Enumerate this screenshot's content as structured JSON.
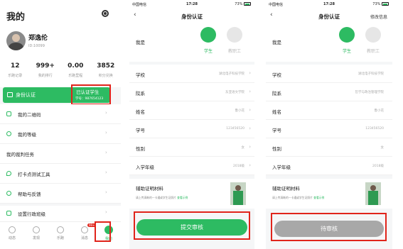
{
  "colors": {
    "accent": "#2dbb62",
    "highlight": "#e0241b",
    "disabled": "#a8a8a8"
  },
  "profile": {
    "title": "我的",
    "name": "郑逸伦",
    "id": "ID:10099",
    "stats": [
      {
        "value": "12",
        "label": "乐跑记录"
      },
      {
        "value": "999+",
        "label": "我的排行"
      },
      {
        "value": "0.00",
        "label": "乐跑里程"
      },
      {
        "value": "3852",
        "label": "积分兑换"
      }
    ],
    "auth": {
      "label": "身份认证",
      "status": "已认证学生",
      "student_id": "学号：987654123"
    },
    "menu": [
      {
        "label": "我的二维码",
        "icon": "qrcode-icon"
      },
      {
        "label": "我的等级",
        "icon": "level-icon"
      },
      {
        "label": "我的裁判任务",
        "icon": ""
      },
      {
        "label": "打卡点测试工具",
        "icon": "location-icon"
      },
      {
        "label": "帮助与反馈",
        "icon": "help-icon"
      },
      {
        "label": "设置行政班级",
        "icon": "class-icon"
      }
    ],
    "tabs": [
      {
        "label": "动态",
        "icon": "feed-icon"
      },
      {
        "label": "发现",
        "icon": "discover-icon"
      },
      {
        "label": "乐跑",
        "icon": "run-icon"
      },
      {
        "label": "消息",
        "icon": "message-icon",
        "badge": "99+"
      },
      {
        "label": "我的",
        "icon": "me-icon",
        "active": true
      }
    ]
  },
  "status_bar": {
    "carrier": "中国电信",
    "time": "17:28",
    "battery": "73%"
  },
  "form_submit": {
    "title": "身份认证",
    "roles_label": "我是",
    "roles": [
      {
        "label": "学生",
        "selected": true
      },
      {
        "label": "教职工",
        "selected": false
      }
    ],
    "rows": [
      {
        "label": "学校",
        "value": "湖北电子科技学院"
      },
      {
        "label": "院系",
        "value": "东亚语文学院"
      },
      {
        "label": "姓名",
        "value": "鲁小花"
      },
      {
        "label": "学号",
        "value": "123456520"
      },
      {
        "label": "性别",
        "value": "女"
      },
      {
        "label": "入学年级",
        "value": "2018级"
      }
    ],
    "material": {
      "title": "辅助证明材料",
      "hint": "请上传清晰的一卡通或学生证照片",
      "hint_link": "查看示例"
    },
    "button": "提交审核"
  },
  "form_pending": {
    "title": "身份认证",
    "edit": "修改信息",
    "roles_label": "我是",
    "roles": [
      {
        "label": "学生",
        "selected": true
      },
      {
        "label": "教职工",
        "selected": false
      }
    ],
    "rows": [
      {
        "label": "学校",
        "value": "湖北电子科技学院"
      },
      {
        "label": "院系",
        "value": "哲学与政治管理学院"
      },
      {
        "label": "姓名",
        "value": "鲁小花"
      },
      {
        "label": "学号",
        "value": "123456520"
      },
      {
        "label": "性别",
        "value": "女"
      },
      {
        "label": "入学年级",
        "value": "2018级"
      }
    ],
    "material": {
      "title": "辅助证明材料",
      "hint": "请上传清晰的一卡通或学生证照片",
      "hint_link": "查看示例"
    },
    "button": "待审核"
  }
}
